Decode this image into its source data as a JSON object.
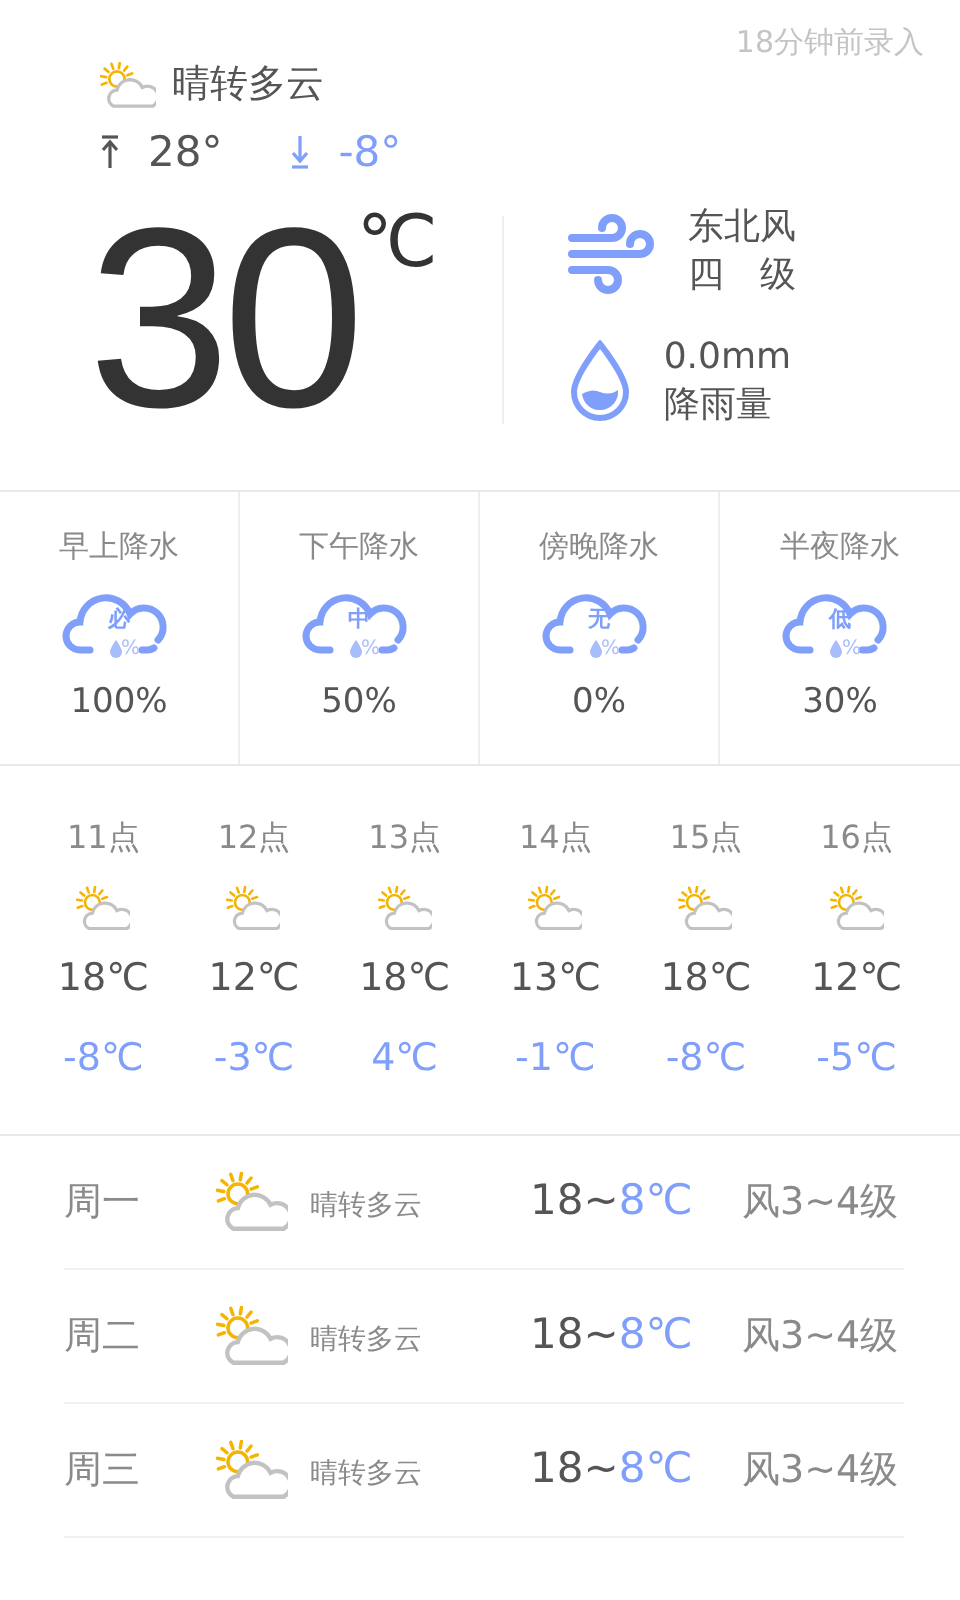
{
  "recorded": "18分钟前录入",
  "current": {
    "condition": "晴转多云",
    "high": "28°",
    "low": "-8°",
    "temperature": "30",
    "unit": "℃"
  },
  "details": [
    {
      "kind": "wind",
      "line_1": "东北风",
      "line_2": "四　级"
    },
    {
      "kind": "rain",
      "line_1": "0.0mm",
      "line_2": "降雨量"
    }
  ],
  "precipitation": [
    {
      "label": "早上降水",
      "cloud_text": "必",
      "cloud_sub": "%",
      "value": "100%"
    },
    {
      "label": "下午降水",
      "cloud_text": "中",
      "cloud_sub": "%",
      "value": "50%"
    },
    {
      "label": "傍晚降水",
      "cloud_text": "无",
      "cloud_sub": "%",
      "value": "0%"
    },
    {
      "label": "半夜降水",
      "cloud_text": "低",
      "cloud_sub": "%",
      "value": "30%"
    }
  ],
  "hourly": [
    {
      "time": "11点",
      "high": "18℃",
      "low": "-8℃"
    },
    {
      "time": "12点",
      "high": "12℃",
      "low": "-3℃"
    },
    {
      "time": "13点",
      "high": "18℃",
      "low": "4℃"
    },
    {
      "time": "14点",
      "high": "13℃",
      "low": "-1℃"
    },
    {
      "time": "15点",
      "high": "18℃",
      "low": "-8℃"
    },
    {
      "time": "16点",
      "high": "12℃",
      "low": "-5℃"
    }
  ],
  "daily": [
    {
      "day": "周一",
      "condition": "晴转多云",
      "high": "18~",
      "low": "8℃",
      "wind": "风3~4级"
    },
    {
      "day": "周二",
      "condition": "晴转多云",
      "high": "18~",
      "low": "8℃",
      "wind": "风3~4级"
    },
    {
      "day": "周三",
      "condition": "晴转多云",
      "high": "18~",
      "low": "8℃",
      "wind": "风3~4级"
    }
  ]
}
